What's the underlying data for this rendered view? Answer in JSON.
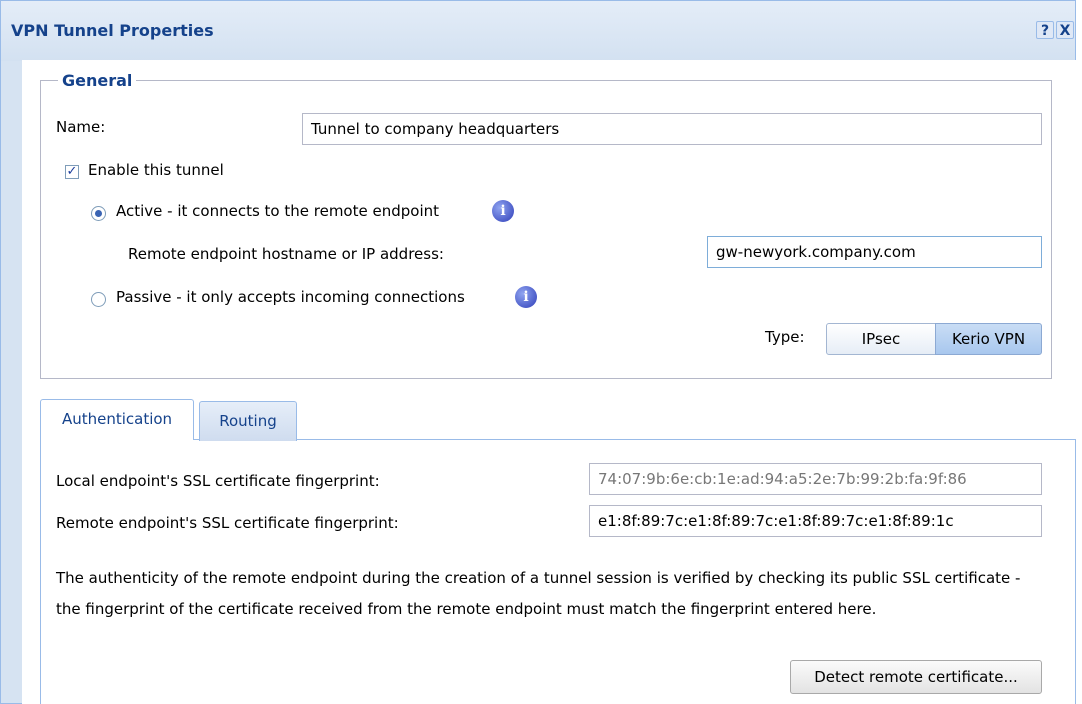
{
  "dialog": {
    "title": "VPN Tunnel Properties",
    "help_label": "?",
    "close_label": "X"
  },
  "general": {
    "legend": "General",
    "name_label": "Name:",
    "name_value": "Tunnel to company headquarters",
    "enable_label": "Enable this tunnel",
    "enable_checked": true,
    "active_label": "Active - it connects to the remote endpoint",
    "remote_label": "Remote endpoint hostname or IP address:",
    "remote_value": "gw-newyork.company.com",
    "passive_label": "Passive - it only accepts incoming connections",
    "mode_selected": "active",
    "info_glyph": "i",
    "type_label": "Type:",
    "type_options": [
      "IPsec",
      "Kerio VPN"
    ],
    "type_selected": "Kerio VPN"
  },
  "tabs": {
    "authentication": "Authentication",
    "routing": "Routing",
    "selected": "Authentication"
  },
  "auth": {
    "local_label": "Local endpoint's SSL certificate fingerprint:",
    "local_value": "74:07:9b:6e:cb:1e:ad:94:a5:2e:7b:99:2b:fa:9f:86",
    "remote_label": "Remote endpoint's SSL certificate fingerprint:",
    "remote_value": "e1:8f:89:7c:e1:8f:89:7c:e1:8f:89:7c:e1:8f:89:1c",
    "description": "The authenticity of the remote endpoint during the creation of a tunnel session is verified by checking its public SSL certificate - the fingerprint of the certificate received from the remote endpoint must match the fingerprint entered here.",
    "detect_button": "Detect remote certificate..."
  },
  "colors": {
    "title": "#15428b",
    "panel_border": "#99bbe8",
    "selected_segment": "#a8c7ee"
  }
}
